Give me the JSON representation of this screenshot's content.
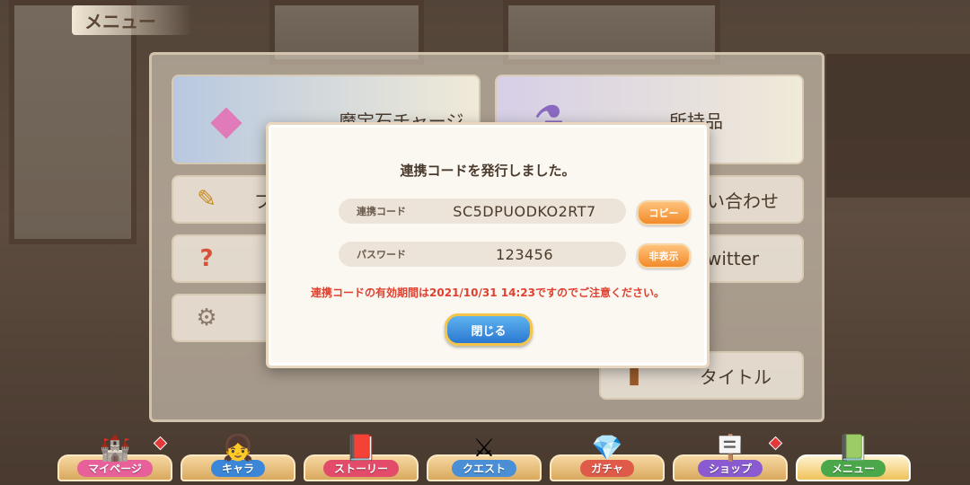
{
  "screen": {
    "title": "メニュー"
  },
  "menu": {
    "cards": [
      {
        "label": "魔宝石チャージ"
      },
      {
        "label": "所持品"
      },
      {
        "label": "プロ"
      },
      {
        "label": "い合わせ"
      },
      {
        "label": "witter"
      },
      {
        "label": "タイトル"
      }
    ]
  },
  "modal": {
    "title": "連携コードを発行しました。",
    "code_label": "連携コード",
    "code_value": "SC5DPUODKO2RT7",
    "copy_button": "コピー",
    "password_label": "パスワード",
    "password_value": "123456",
    "hide_button": "非表示",
    "notice": "連携コードの有効期間は2021/10/31 14:23ですのでご注意ください。",
    "close_button": "閉じる"
  },
  "nav": {
    "items": [
      {
        "label": "マイページ",
        "color": "#e8609a",
        "badge": true
      },
      {
        "label": "キャラ",
        "color": "#3a86d9",
        "badge": false
      },
      {
        "label": "ストーリー",
        "color": "#e24c6a",
        "badge": false
      },
      {
        "label": "クエスト",
        "color": "#4a8fd6",
        "badge": false
      },
      {
        "label": "ガチャ",
        "color": "#e05a4a",
        "badge": false
      },
      {
        "label": "ショップ",
        "color": "#8a5ad0",
        "badge": true
      },
      {
        "label": "メニュー",
        "color": "#4aa84a",
        "badge": false
      }
    ]
  }
}
